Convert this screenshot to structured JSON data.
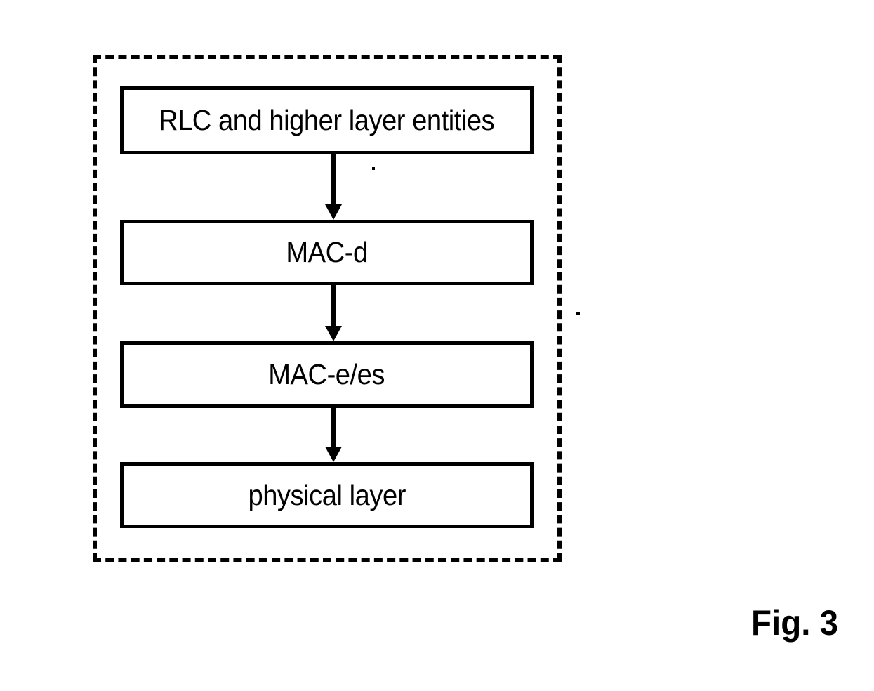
{
  "figure": {
    "caption": "Fig. 3",
    "enclosure_label": "",
    "boxes": [
      {
        "id": "rlc",
        "label": "RLC and higher layer entities"
      },
      {
        "id": "mac-d",
        "label": "MAC-d"
      },
      {
        "id": "mac-e-es",
        "label": "MAC-e/es"
      },
      {
        "id": "phy",
        "label": "physical layer"
      }
    ],
    "connectors": [
      {
        "from": "rlc",
        "to": "mac-d",
        "direction": "down",
        "style": "solid-arrow"
      },
      {
        "from": "mac-d",
        "to": "mac-e-es",
        "direction": "down",
        "style": "solid-arrow"
      },
      {
        "from": "mac-e-es",
        "to": "phy",
        "direction": "down",
        "style": "solid-arrow"
      }
    ],
    "colors": {
      "ink": "#000000",
      "paper": "#ffffff"
    },
    "line_styles": {
      "enclosure": "dashed",
      "box": "solid"
    }
  }
}
